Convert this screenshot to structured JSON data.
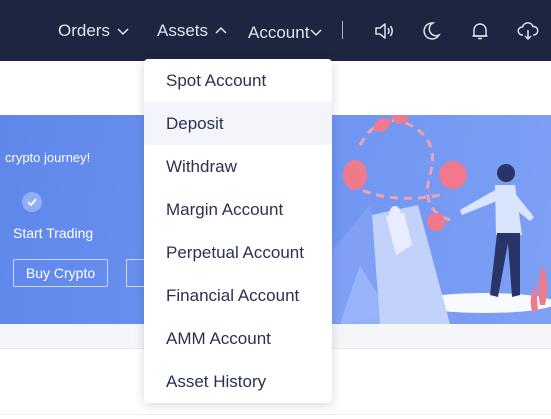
{
  "nav": {
    "orders": "Orders",
    "assets": "Assets",
    "account": "Account",
    "icons": [
      "speaker-icon",
      "moon-icon",
      "bell-icon",
      "download-icon"
    ]
  },
  "banner": {
    "headline": "crypto journey!",
    "step_label": "Start Trading",
    "buy_button": "Buy Crypto"
  },
  "dropdown": {
    "items": [
      {
        "label": "Spot Account"
      },
      {
        "label": "Deposit"
      },
      {
        "label": "Withdraw"
      },
      {
        "label": "Margin Account"
      },
      {
        "label": "Perpetual Account"
      },
      {
        "label": "Financial Account"
      },
      {
        "label": "AMM Account"
      },
      {
        "label": "Asset History"
      }
    ],
    "highlighted": "Deposit"
  },
  "colors": {
    "nav_bg": "#1e2540",
    "banner_blue": "#6a8ff0",
    "accent_pink": "#f07a8c"
  }
}
